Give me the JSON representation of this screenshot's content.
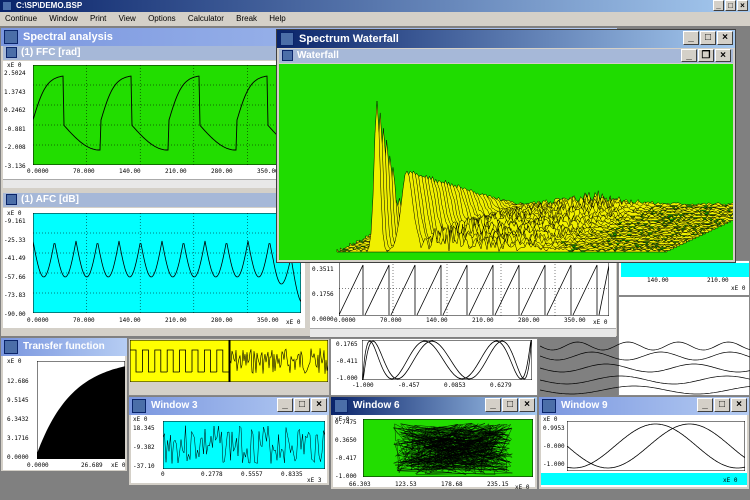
{
  "app": {
    "title": "C:\\SP\\DEMO.BSP"
  },
  "menu": [
    "Continue",
    "Window",
    "Print",
    "View",
    "Options",
    "Calculator",
    "Break",
    "Help"
  ],
  "windows": {
    "spectral": {
      "title": "Spectral analysis",
      "ffc": {
        "title": "(1)  FFC [rad]",
        "exp": "xE 0",
        "yticks": [
          "2.5024",
          "1.3743",
          "0.2462",
          "-0.881",
          "-2.008",
          "-3.136"
        ],
        "xticks": [
          "0.0000",
          "70.000",
          "140.00",
          "210.00",
          "280.00",
          "350.00"
        ]
      },
      "afc": {
        "title": "(1)  AFC [dB]",
        "exp": "xE 0",
        "yticks": [
          "-9.161",
          "-25.33",
          "-41.49",
          "-57.66",
          "-73.83",
          "-90.00"
        ],
        "xticks": [
          "0.0000",
          "70.000",
          "140.00",
          "210.00",
          "280.00",
          "350.00"
        ],
        "xexp": "xE 0"
      },
      "saw": {
        "yticks": [
          "0.3511",
          "0.1756",
          "0.0000"
        ],
        "xticks": [
          "0.0000",
          "70.000",
          "140.00",
          "210.00",
          "280.00",
          "350.00"
        ],
        "xexp": "xE 0"
      }
    },
    "waterfall": {
      "outer_title": "Spectrum Waterfall",
      "inner_title": "Waterfall",
      "bg": "#1fdc00",
      "fill": "#f0f000"
    },
    "transfer": {
      "title": "Transfer function",
      "exp": "xE 0",
      "yticks": [
        "12.686",
        "9.5145",
        "6.3432",
        "3.1716",
        "0.0000"
      ],
      "xticks": [
        "0.0000",
        "26.689"
      ],
      "xexp": "xE 0"
    },
    "window3": {
      "title": "Window 3",
      "exp": "xE 0",
      "yticks": [
        "18.345",
        "-9.382",
        "-37.10"
      ],
      "xticks": [
        "0",
        "0.2778",
        "0.5557",
        "0.8335"
      ],
      "xexp": "xE 3"
    },
    "window6": {
      "title": "Window 6",
      "exp": "xE 0",
      "yticks": [
        "0.7475",
        "0.3650",
        "-0.417",
        "-1.000"
      ],
      "xticks": [
        "66.303",
        "123.53",
        "178.68",
        "235.15"
      ],
      "xexp": "xE 0"
    },
    "window9": {
      "title": "Window 9",
      "exp": "xE 0",
      "yticks": [
        "0.9953",
        "-0.000",
        "-1.000"
      ],
      "xexp": "xE 0"
    },
    "lissajous": {
      "yticks": [
        "0.1765",
        "-0.411",
        "-1.000"
      ],
      "xticks": [
        "-1.000",
        "-0.457",
        "0.0853",
        "0.6279"
      ],
      "xexp": "xE 0"
    },
    "right_top": {
      "xticks": [
        "140.00",
        "210.00"
      ],
      "xexp": "xE 0"
    }
  },
  "colors": {
    "cyan": "#00ffff",
    "green": "#22dd00",
    "titlebar": "#0a246a",
    "yellow": "#ffff00"
  }
}
